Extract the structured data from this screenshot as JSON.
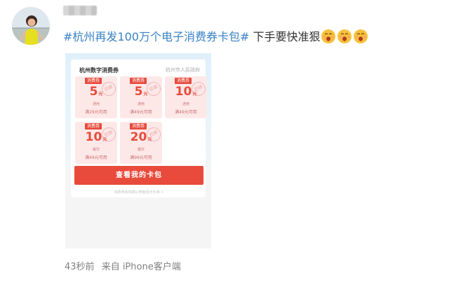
{
  "post": {
    "hashtag": "#杭州再发100万个电子消费券卡包#",
    "text": " 下手要快准狠",
    "emoji_name": "face-with-open-mouth-emoji",
    "emoji_count": 3
  },
  "card": {
    "title": "杭州数字消费券",
    "org": "杭州市人民政府",
    "coupons": [
      {
        "tag": "消费券",
        "amount": "5",
        "unit": "元",
        "stamp": "已领",
        "type": "通用",
        "condition": "满29元可用"
      },
      {
        "tag": "消费券",
        "amount": "5",
        "unit": "元",
        "stamp": "已领",
        "type": "通用",
        "condition": "满49元可用"
      },
      {
        "tag": "消费券",
        "amount": "10",
        "unit": "元",
        "stamp": "已领",
        "type": "通用",
        "condition": "满49元可用"
      },
      {
        "tag": "消费券",
        "amount": "10",
        "unit": "元",
        "stamp": "已领",
        "type": "餐饮",
        "condition": "满49元可用"
      },
      {
        "tag": "消费券",
        "amount": "20",
        "unit": "元",
        "stamp": "已领",
        "type": "餐饮",
        "condition": "满99元可用"
      }
    ],
    "cta_label": "查看我的卡包",
    "footnote": "消费券有效期以券面显示为准 >"
  },
  "meta": {
    "time": "43秒前",
    "source": "来自 iPhone客户端"
  },
  "colors": {
    "hashtag": "#3a82c4",
    "accent_red": "#e84b3c",
    "coupon_bg": "#fde8e8"
  }
}
